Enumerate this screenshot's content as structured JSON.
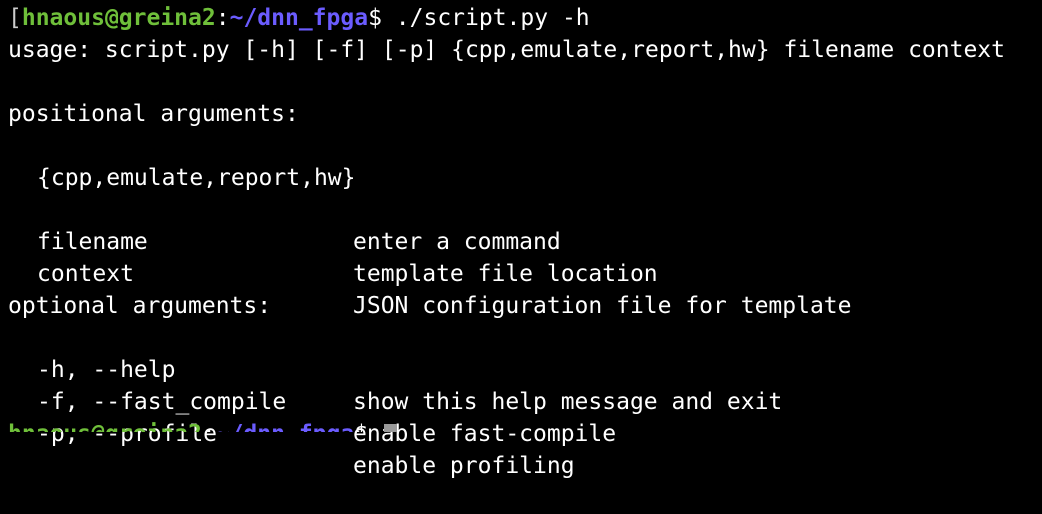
{
  "prompt": {
    "bracket": "[",
    "user_host": "hnaous@greina2",
    "colon": ":",
    "path": "~/dnn_fpga",
    "dollar": "$",
    "command": " ./script.py -h"
  },
  "usage": "usage: script.py [-h] [-f] [-p] {cpp,emulate,report,hw} filename context",
  "positional_header": "positional arguments:",
  "positional": [
    {
      "arg": "{cpp,emulate,report,hw}",
      "desc": ""
    },
    {
      "arg": "",
      "desc": "enter a command"
    },
    {
      "arg": "filename",
      "desc": "template file location"
    },
    {
      "arg": "context",
      "desc": "JSON configuration file for template"
    }
  ],
  "optional_header": "optional arguments:",
  "optional": [
    {
      "arg": "-h, --help",
      "desc": "show this help message and exit"
    },
    {
      "arg": "-f, --fast_compile",
      "desc": "enable fast-compile"
    },
    {
      "arg": "-p, --profile",
      "desc": "enable profiling"
    }
  ],
  "next_prompt": {
    "user_host": "hnaous@greina2",
    "colon": ":",
    "path": "~/dnn_fpga",
    "dollar": "$"
  },
  "colors": {
    "background": "#000000",
    "user": "#6fbf3a",
    "path": "#6b5cff",
    "text": "#ffffff"
  }
}
